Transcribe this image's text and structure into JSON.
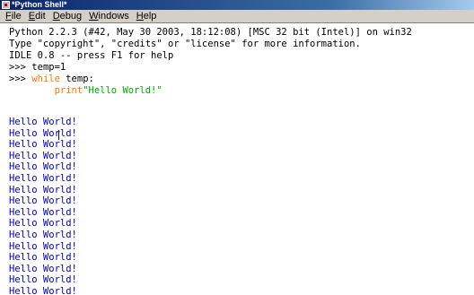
{
  "window": {
    "title": "*Python Shell*"
  },
  "menu": [
    {
      "mnemonic": "F",
      "rest": "ile"
    },
    {
      "mnemonic": "E",
      "rest": "dit"
    },
    {
      "mnemonic": "D",
      "rest": "ebug"
    },
    {
      "mnemonic": "W",
      "rest": "indows"
    },
    {
      "mnemonic": "H",
      "rest": "elp"
    }
  ],
  "shell": {
    "banner": [
      "Python 2.2.3 (#42, May 30 2003, 18:12:08) [MSC 32 bit (Intel)] on win32",
      "Type \"copyright\", \"credits\" or \"license\" for more information.",
      "IDLE 0.8 -- press F1 for help"
    ],
    "prompt": ">>> ",
    "cmd1": "temp=1",
    "cmd2_kw": "while",
    "cmd2_rest": " temp:",
    "cmd3_indent": "        ",
    "cmd3_kw": "print",
    "cmd3_str": "\"Hello World!\"",
    "output_line": "Hello World!",
    "output_count": 16
  },
  "colors": {
    "keyword": "#ff7700",
    "string": "#00aa00",
    "output": "#0000c0",
    "titlebar": "#0a246a"
  }
}
